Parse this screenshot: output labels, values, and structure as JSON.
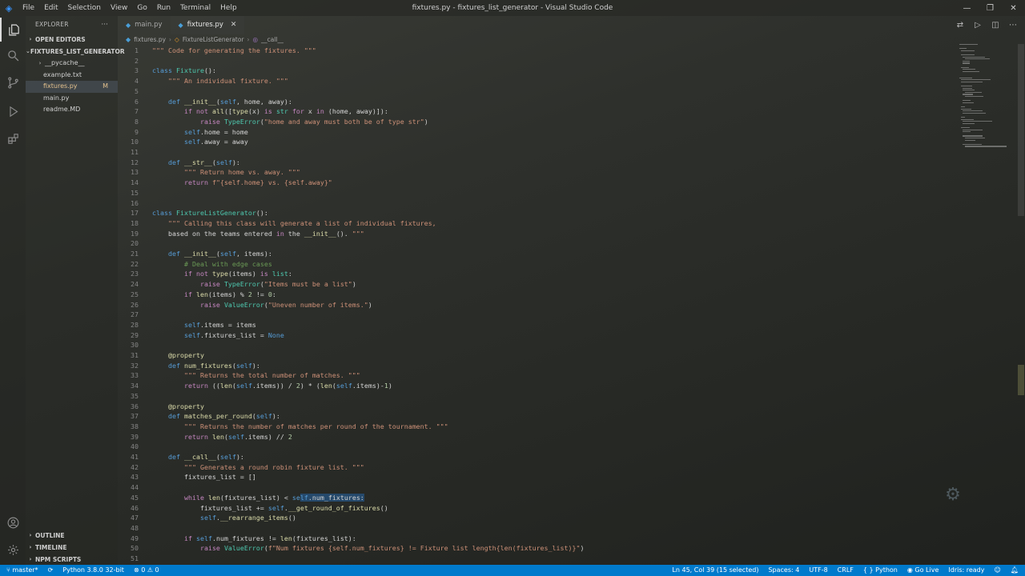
{
  "window": {
    "title": "fixtures.py - fixtures_list_generator - Visual Studio Code",
    "menu": [
      "File",
      "Edit",
      "Selection",
      "View",
      "Go",
      "Run",
      "Terminal",
      "Help"
    ]
  },
  "sidebar": {
    "header": "EXPLORER",
    "more": "···",
    "open_editors": "OPEN EDITORS",
    "project": "FIXTURES_LIST_GENERATOR",
    "files": [
      {
        "name": "__pycache__",
        "kind": "folder"
      },
      {
        "name": "example.txt",
        "kind": "file"
      },
      {
        "name": "fixtures.py",
        "kind": "file",
        "badge": "M"
      },
      {
        "name": "main.py",
        "kind": "file"
      },
      {
        "name": "readme.MD",
        "kind": "file"
      }
    ],
    "outline": "OUTLINE",
    "timeline": "TIMELINE",
    "npm": "NPM SCRIPTS"
  },
  "tabs": [
    {
      "label": "main.py",
      "active": false
    },
    {
      "label": "fixtures.py",
      "active": true
    }
  ],
  "breadcrumb": [
    "fixtures.py",
    "FixtureListGenerator",
    "__call__"
  ],
  "code_lines": [
    {
      "n": "1",
      "t": "\"\"\" Code for generating the fixtures. \"\"\""
    },
    {
      "n": "2",
      "t": ""
    },
    {
      "n": "3",
      "t": "class Fixture():"
    },
    {
      "n": "4",
      "t": "    \"\"\" An individual fixture. \"\"\""
    },
    {
      "n": "5",
      "t": ""
    },
    {
      "n": "6",
      "t": "    def __init__(self, home, away):"
    },
    {
      "n": "7",
      "t": "        if not all([type(x) is str for x in (home, away)]):"
    },
    {
      "n": "8",
      "t": "            raise TypeError(\"home and away must both be of type str\")"
    },
    {
      "n": "9",
      "t": "        self.home = home"
    },
    {
      "n": "10",
      "t": "        self.away = away"
    },
    {
      "n": "11",
      "t": ""
    },
    {
      "n": "12",
      "t": "    def __str__(self):"
    },
    {
      "n": "13",
      "t": "        \"\"\" Return home vs. away. \"\"\""
    },
    {
      "n": "14",
      "t": "        return f\"{self.home} vs. {self.away}\""
    },
    {
      "n": "15",
      "t": ""
    },
    {
      "n": "16",
      "t": ""
    },
    {
      "n": "17",
      "t": "class FixtureListGenerator():"
    },
    {
      "n": "18",
      "t": "    \"\"\" Calling this class will generate a list of individual fixtures,"
    },
    {
      "n": "19",
      "t": "    based on the teams entered in the __init__(). \"\"\""
    },
    {
      "n": "20",
      "t": ""
    },
    {
      "n": "21",
      "t": "    def __init__(self, items):"
    },
    {
      "n": "22",
      "t": "        # Deal with edge cases"
    },
    {
      "n": "23",
      "t": "        if not type(items) is list:"
    },
    {
      "n": "24",
      "t": "            raise TypeError(\"Items must be a list\")"
    },
    {
      "n": "25",
      "t": "        if len(items) % 2 != 0:"
    },
    {
      "n": "26",
      "t": "            raise ValueError(\"Uneven number of items.\")"
    },
    {
      "n": "27",
      "t": ""
    },
    {
      "n": "28",
      "t": "        self.items = items"
    },
    {
      "n": "29",
      "t": "        self.fixtures_list = None"
    },
    {
      "n": "30",
      "t": ""
    },
    {
      "n": "31",
      "t": "    @property"
    },
    {
      "n": "32",
      "t": "    def num_fixtures(self):"
    },
    {
      "n": "33",
      "t": "        \"\"\" Returns the total number of matches. \"\"\""
    },
    {
      "n": "34",
      "t": "        return ((len(self.items)) / 2) * (len(self.items)-1)"
    },
    {
      "n": "35",
      "t": ""
    },
    {
      "n": "36",
      "t": "    @property"
    },
    {
      "n": "37",
      "t": "    def matches_per_round(self):"
    },
    {
      "n": "38",
      "t": "        \"\"\" Returns the number of matches per round of the tournament. \"\"\""
    },
    {
      "n": "39",
      "t": "        return len(self.items) // 2"
    },
    {
      "n": "40",
      "t": ""
    },
    {
      "n": "41",
      "t": "    def __call__(self):"
    },
    {
      "n": "42",
      "t": "        \"\"\" Generates a round robin fixture list. \"\"\""
    },
    {
      "n": "43",
      "t": "        fixtures_list = []"
    },
    {
      "n": "44",
      "t": ""
    },
    {
      "n": "45",
      "t": "        while len(fixtures_list) < self.num_fixtures:"
    },
    {
      "n": "46",
      "t": "            fixtures_list += self.__get_round_of_fixtures()"
    },
    {
      "n": "47",
      "t": "            self.__rearrange_items()"
    },
    {
      "n": "48",
      "t": ""
    },
    {
      "n": "49",
      "t": "        if self.num_fixtures != len(fixtures_list):"
    },
    {
      "n": "50",
      "t": "            raise ValueError(f\"Num fixtures {self.num_fixtures} != Fixture list length{len(fixtures_list)}\")"
    },
    {
      "n": "51",
      "t": ""
    }
  ],
  "statusbar": {
    "branch": "master*",
    "python": "Python 3.8.0 32-bit",
    "problems": "⊗ 0 ⚠ 0",
    "cursor": "Ln 45, Col 39 (15 selected)",
    "spaces": "Spaces: 4",
    "encoding": "UTF-8",
    "eol": "CRLF",
    "language": "Python",
    "golive": "Go Live",
    "idris": "Idris: ready"
  },
  "colors": {
    "status_bg": "#007acc",
    "keyword": "#569cd6",
    "class": "#4ec9b0",
    "function": "#dcdcaa",
    "string": "#ce9178",
    "comment": "#6a9955"
  }
}
